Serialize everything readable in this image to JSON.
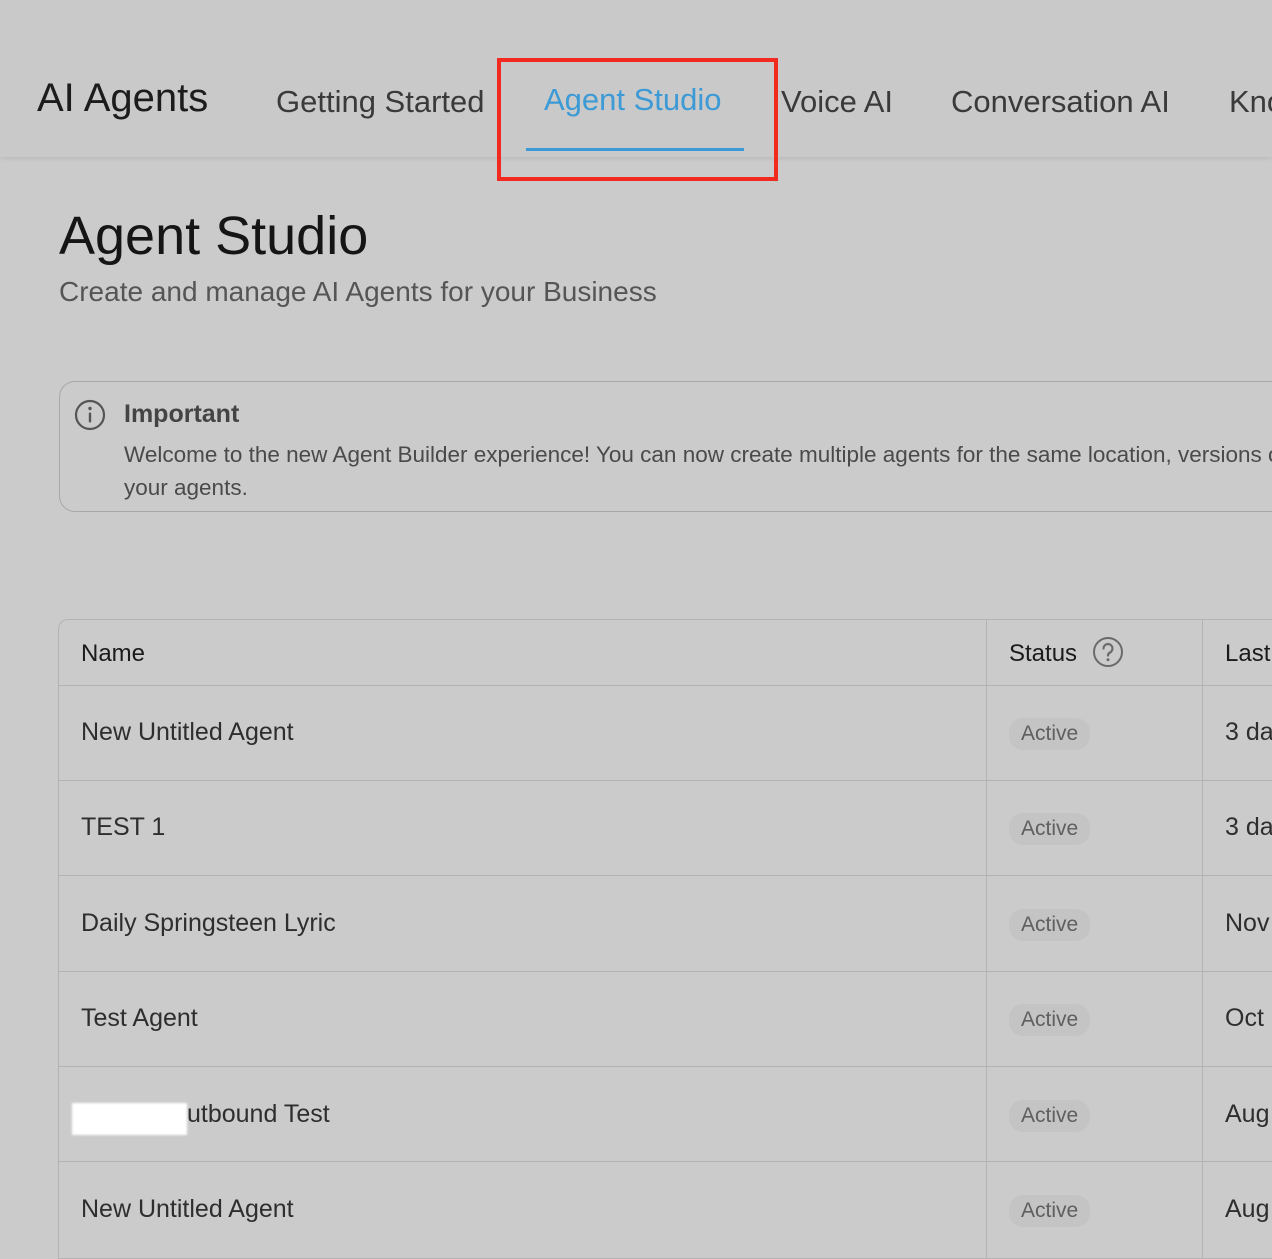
{
  "header": {
    "app_title": "AI Agents",
    "tabs": [
      {
        "label": "Getting Started",
        "active": false
      },
      {
        "label": "Agent Studio",
        "active": true
      },
      {
        "label": "Voice AI",
        "active": false
      },
      {
        "label": "Conversation AI",
        "active": false
      },
      {
        "label": "Kno",
        "active": false
      }
    ]
  },
  "page": {
    "title": "Agent Studio",
    "subtitle": "Create and manage AI Agents for your Business"
  },
  "notice": {
    "icon": "info-icon",
    "title": "Important",
    "body": "Welcome to the new Agent Builder experience! You can now create multiple agents for the same location, versions of your agents."
  },
  "table": {
    "columns": {
      "name": "Name",
      "status": "Status",
      "last_updated": "Last"
    },
    "status_help_icon": "question-circle-icon",
    "rows": [
      {
        "name": "New Untitled Agent",
        "status": "Active",
        "updated": "3 da"
      },
      {
        "name": "TEST 1",
        "status": "Active",
        "updated": "3 da"
      },
      {
        "name": "Daily Springsteen Lyric",
        "status": "Active",
        "updated": "Nov"
      },
      {
        "name": "Test Agent",
        "status": "Active",
        "updated": "Oct"
      },
      {
        "name": "utbound Test",
        "status": "Active",
        "updated": "Aug"
      },
      {
        "name": "New Untitled Agent",
        "status": "Active",
        "updated": "Aug"
      }
    ]
  },
  "colors": {
    "accent": "#3c9ad6",
    "highlight": "#f2291e",
    "background": "#cbcbcb"
  }
}
